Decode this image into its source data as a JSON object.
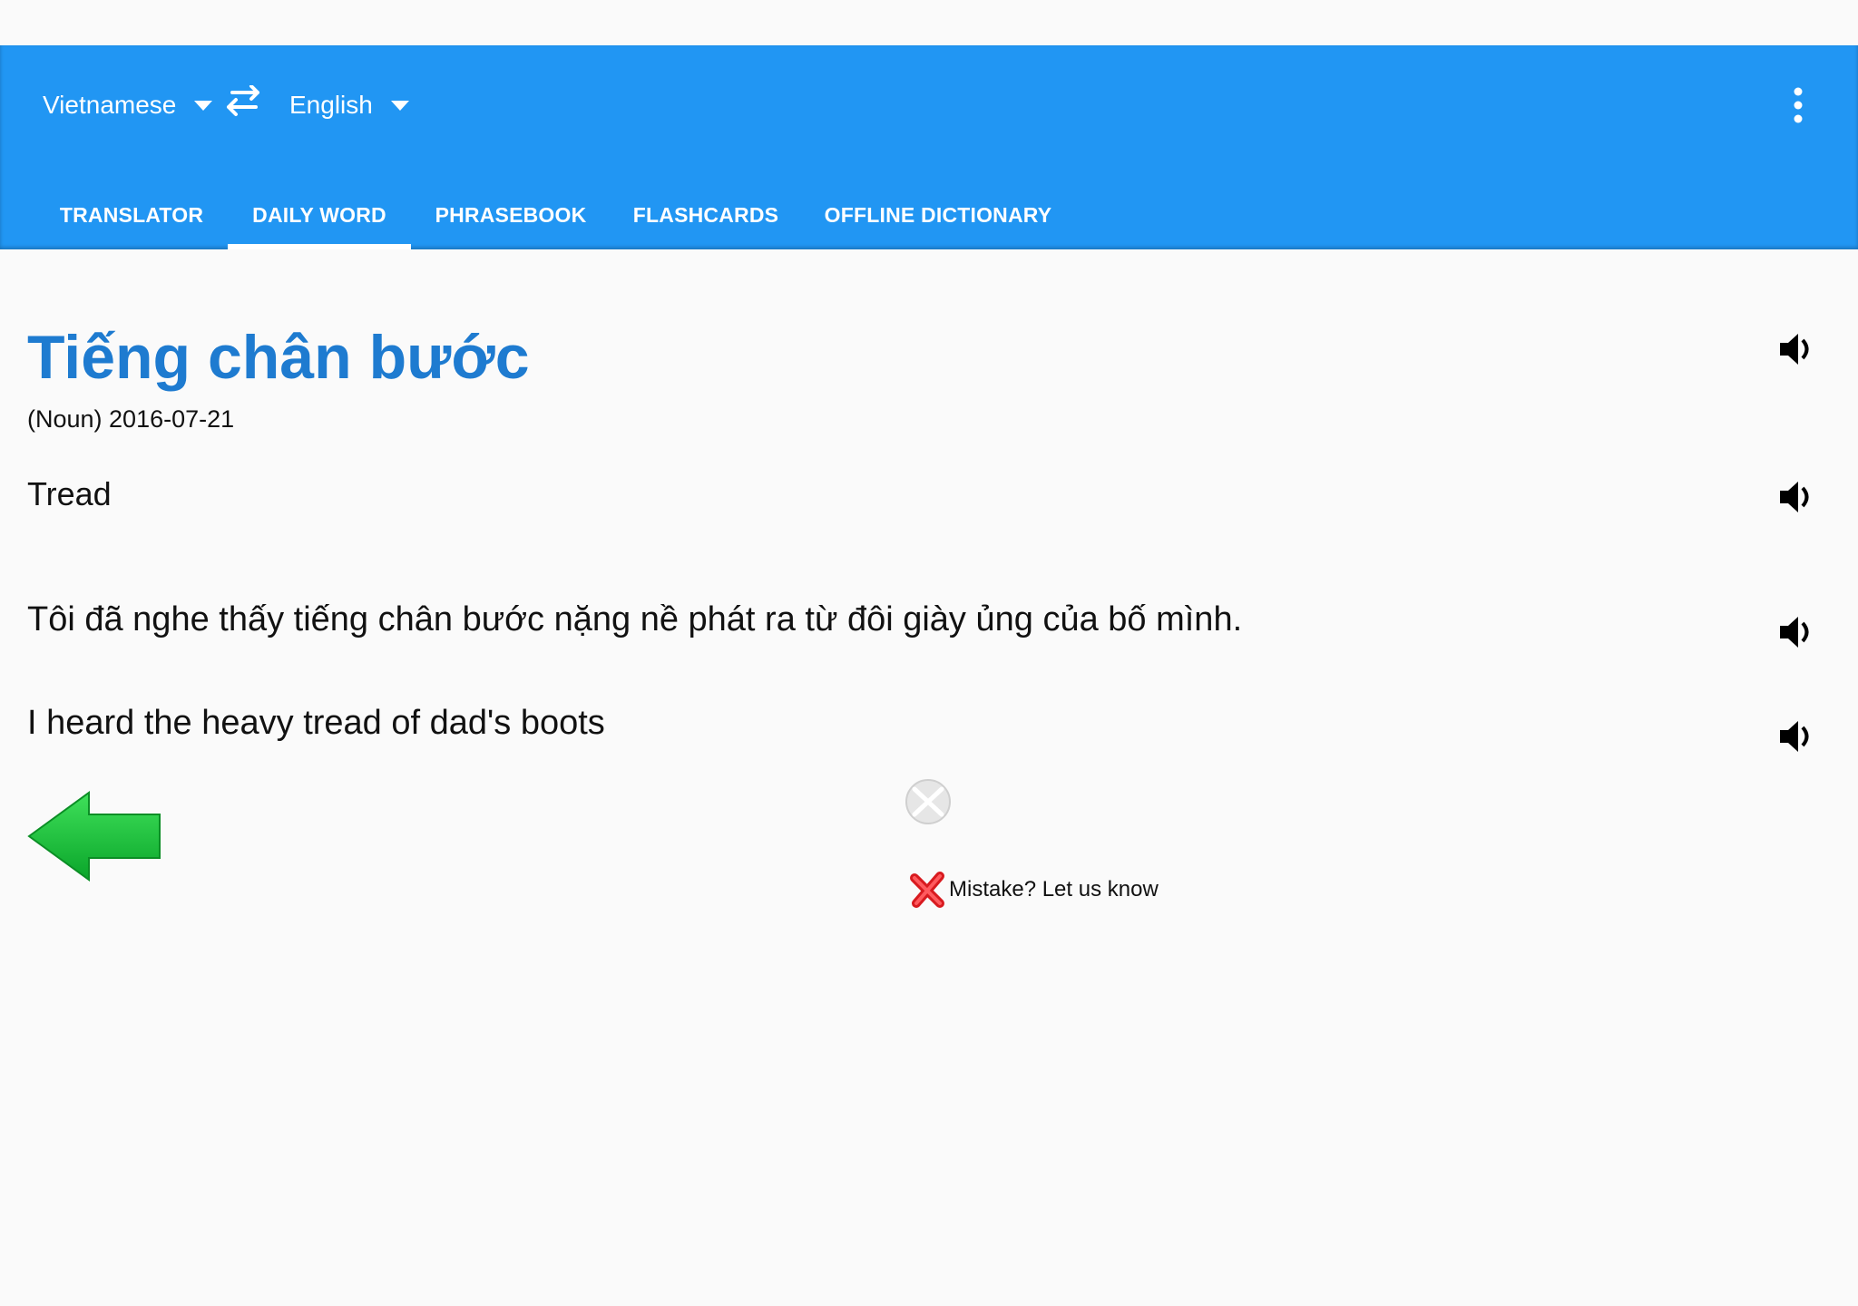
{
  "header": {
    "source_language": "Vietnamese",
    "target_language": "English",
    "swap_icon": "swap-arrows-icon",
    "menu_icon": "more-vert-icon"
  },
  "tabs": [
    {
      "label": "TRANSLATOR",
      "active": false
    },
    {
      "label": "DAILY WORD",
      "active": true
    },
    {
      "label": "PHRASEBOOK",
      "active": false
    },
    {
      "label": "FLASHCARDS",
      "active": false
    },
    {
      "label": "OFFLINE DICTIONARY",
      "active": false
    }
  ],
  "daily_word": {
    "word": "Tiếng chân bước",
    "meta": "(Noun) 2016-07-21",
    "translation": "Tread",
    "example_vi": "Tôi đã nghe thấy tiếng chân bước nặng nề phát ra từ đôi giày ủng của bố mình.",
    "example_en": "I heard the heavy tread of dad's boots"
  },
  "actions": {
    "mistake_label": "Mistake? Let us know"
  },
  "colors": {
    "app_bar": "#2196f3",
    "word_title": "#1e7bd0",
    "back_arrow": "#1bc43a",
    "mistake_x": "#e0181e"
  }
}
